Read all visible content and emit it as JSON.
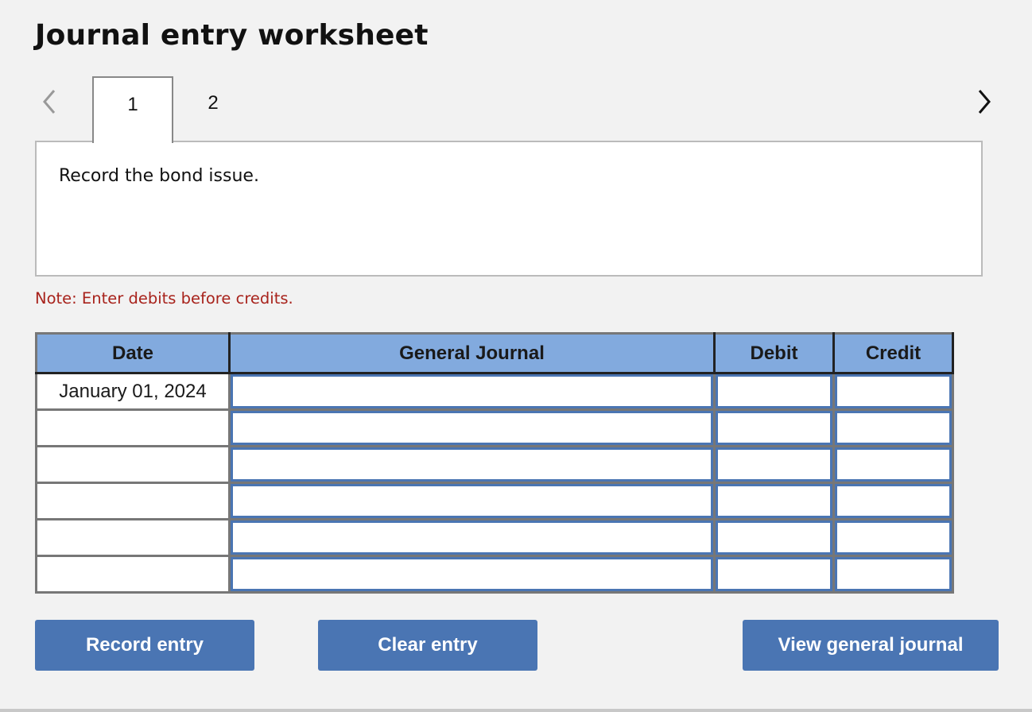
{
  "header": {
    "title": "Journal entry worksheet"
  },
  "navigation": {
    "prev_icon": "chevron-left-icon",
    "next_icon": "chevron-right-icon",
    "tabs": [
      {
        "label": "1",
        "active": true
      },
      {
        "label": "2",
        "active": false
      }
    ]
  },
  "prompt": {
    "text": "Record the bond issue."
  },
  "note": {
    "text": "Note: Enter debits before credits."
  },
  "journal_table": {
    "headers": {
      "date": "Date",
      "general_journal": "General Journal",
      "debit": "Debit",
      "credit": "Credit"
    },
    "rows": [
      {
        "date": "January 01, 2024",
        "account": "",
        "debit": "",
        "credit": ""
      },
      {
        "date": "",
        "account": "",
        "debit": "",
        "credit": ""
      },
      {
        "date": "",
        "account": "",
        "debit": "",
        "credit": ""
      },
      {
        "date": "",
        "account": "",
        "debit": "",
        "credit": ""
      },
      {
        "date": "",
        "account": "",
        "debit": "",
        "credit": ""
      },
      {
        "date": "",
        "account": "",
        "debit": "",
        "credit": ""
      }
    ]
  },
  "buttons": {
    "record": "Record entry",
    "clear": "Clear entry",
    "view": "View general journal"
  },
  "colors": {
    "accent": "#4a75b3",
    "header_bg": "#82aade",
    "note": "#a8231c",
    "page_bg": "#f2f2f2"
  }
}
